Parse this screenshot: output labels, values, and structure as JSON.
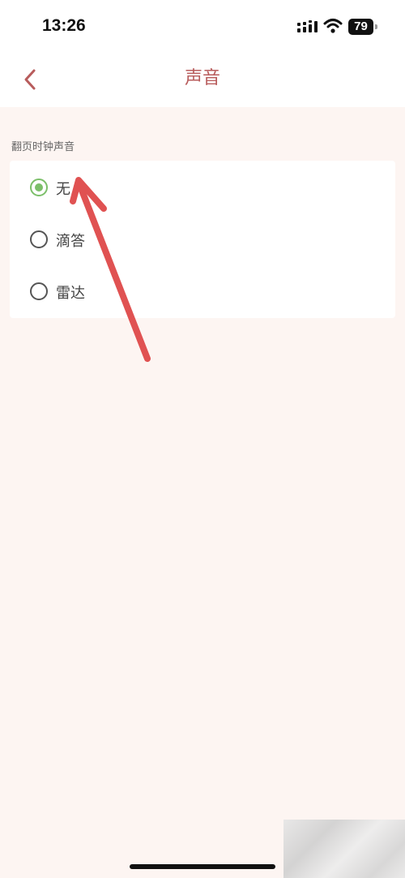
{
  "status_bar": {
    "time": "13:26",
    "battery_level": "79",
    "icons": [
      "signal-icon",
      "wifi-icon",
      "battery-icon"
    ]
  },
  "nav": {
    "title": "声音",
    "back_icon": "chevron-left-icon"
  },
  "section": {
    "label": "翻页时钟声音"
  },
  "options": [
    {
      "label": "无",
      "selected": true
    },
    {
      "label": "滴答",
      "selected": false
    },
    {
      "label": "雷达",
      "selected": false
    }
  ],
  "colors": {
    "accent": "#b85c5c",
    "radio_selected": "#7cbf6a",
    "background": "#fdf5f2",
    "annotation_arrow": "#e05252"
  }
}
